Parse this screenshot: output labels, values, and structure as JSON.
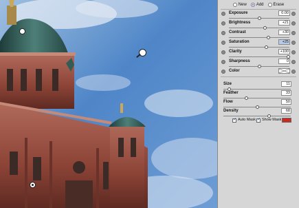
{
  "mode": {
    "options": [
      "New",
      "Add",
      "Erase"
    ],
    "selected": "Add"
  },
  "adjustments": [
    {
      "label": "Exposure",
      "value": "0.00",
      "level": 0.5
    },
    {
      "label": "Brightness",
      "value": "+21",
      "level": 0.6
    },
    {
      "label": "Contrast",
      "value": "+30",
      "level": 0.65
    },
    {
      "label": "Saturation",
      "value": "+25",
      "level": 0.62,
      "selected": true
    },
    {
      "label": "Clarity",
      "value": "+100",
      "level": 1.0
    },
    {
      "label": "Sharpness",
      "value": "0",
      "level": 0.5
    },
    {
      "label": "Color",
      "value": "",
      "level": null
    }
  ],
  "brush": [
    {
      "label": "Size",
      "value": "11",
      "level": 0.06
    },
    {
      "label": "Feather",
      "value": "33",
      "level": 0.33
    },
    {
      "label": "Flow",
      "value": "50",
      "level": 0.5
    },
    {
      "label": "Density",
      "value": "68",
      "level": 0.68
    }
  ],
  "mask": {
    "auto_mask_label": "Auto Mask",
    "auto_mask_checked": true,
    "show_mask_label": "Show Mask",
    "show_mask_checked": true,
    "mask_color": "#cc2a1f"
  },
  "colors": {
    "panel_bg": "#d6d6d6",
    "sky": "#5b8fcf",
    "building": "#8e4a3e",
    "dome": "#2f5a56"
  }
}
